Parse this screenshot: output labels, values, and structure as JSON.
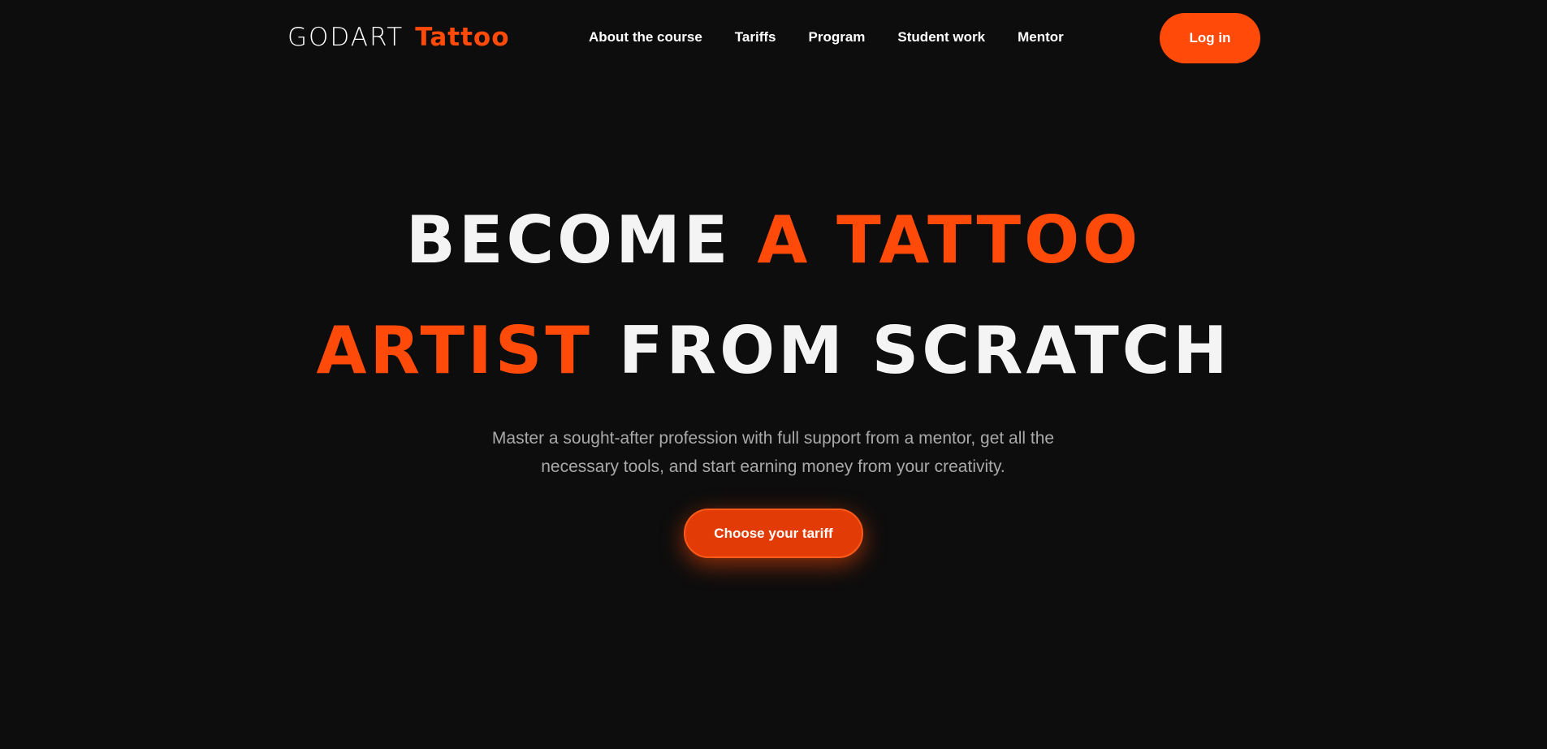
{
  "header": {
    "logo": {
      "brand": "GODART",
      "product": "Tattoo"
    },
    "nav": [
      {
        "label": "About the course"
      },
      {
        "label": "Tariffs"
      },
      {
        "label": "Program"
      },
      {
        "label": "Student work"
      },
      {
        "label": "Mentor"
      }
    ],
    "login_label": "Log in"
  },
  "hero": {
    "line1": {
      "white": "BECOME",
      "orange": "A TATTOO"
    },
    "line2": {
      "orange": "ARTIST",
      "white": "FROM SCRATCH"
    },
    "subtitle_line1": "Master a sought-after profession with full support from a mentor, get all the",
    "subtitle_line2": "necessary tools, and start earning money from your creativity.",
    "cta_label": "Choose your tariff"
  },
  "colors": {
    "background": "#0d0d0d",
    "accent": "#ff4a0a",
    "text": "#f4f4f4",
    "muted": "#a9a9a9"
  }
}
